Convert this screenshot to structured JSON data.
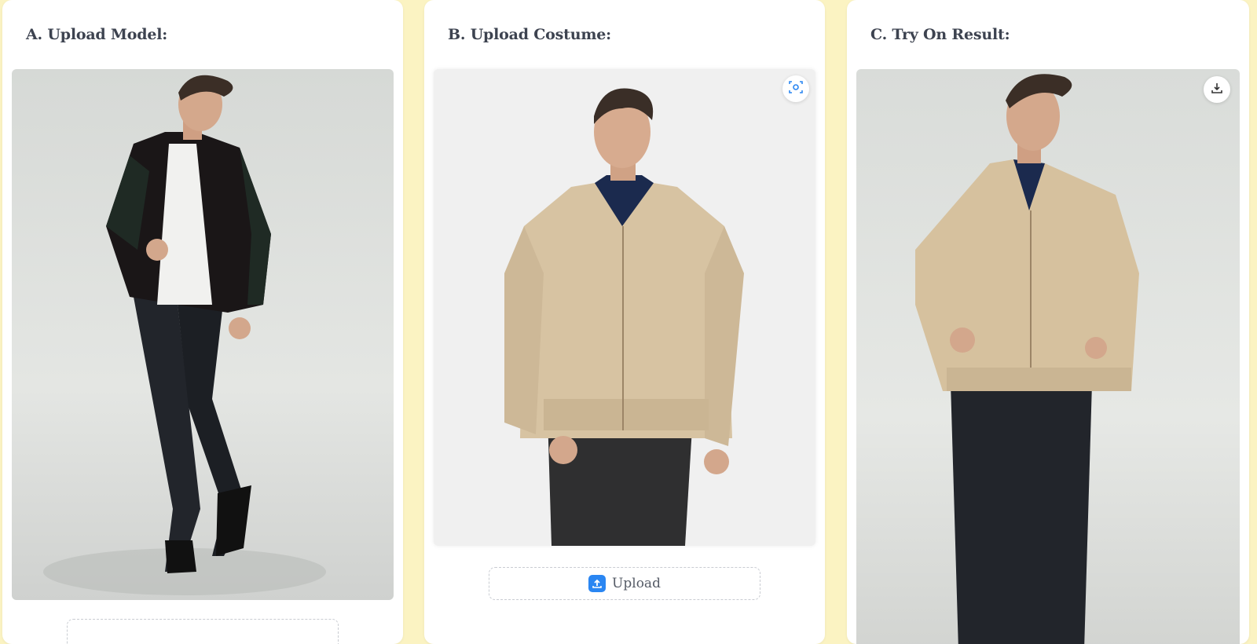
{
  "panels": {
    "model": {
      "title": "A. Upload Model:",
      "image_alt": "model photo",
      "upload_label": ""
    },
    "costume": {
      "title": "B. Upload Costume:",
      "image_alt": "costume photo",
      "upload_label": "Upload"
    },
    "result": {
      "title": "C. Try On Result:",
      "image_alt": "try-on result photo"
    }
  },
  "icons": {
    "costume_corner": "scan-icon",
    "result_corner": "download-icon",
    "upload": "upload-icon"
  },
  "colors": {
    "background": "#fbf3c2",
    "accent": "#2a86f2",
    "title": "#3d4350"
  }
}
